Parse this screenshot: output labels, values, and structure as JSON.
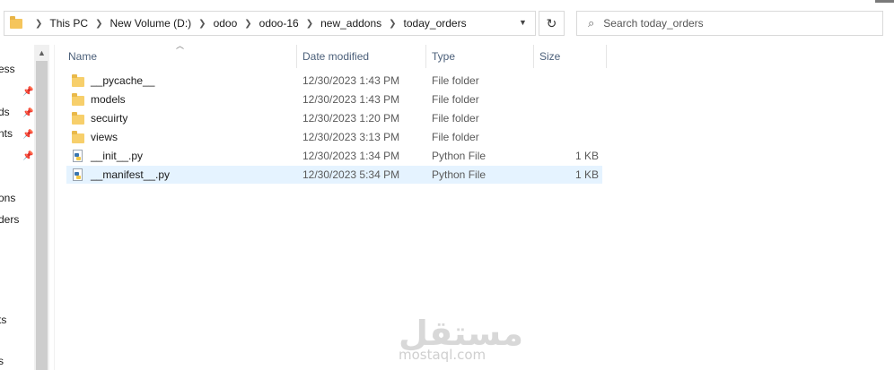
{
  "breadcrumb": [
    "This PC",
    "New Volume (D:)",
    "odoo",
    "odoo-16",
    "new_addons",
    "today_orders"
  ],
  "search": {
    "placeholder": "Search today_orders"
  },
  "nav": {
    "items": [
      "ess",
      "ds",
      "nts",
      "",
      "ons",
      "ders",
      "ts",
      "s"
    ]
  },
  "columns": {
    "name": "Name",
    "date": "Date modified",
    "type": "Type",
    "size": "Size"
  },
  "files": [
    {
      "name": "__pycache__",
      "date": "12/30/2023 1:43 PM",
      "type": "File folder",
      "size": "",
      "kind": "folder",
      "selected": false
    },
    {
      "name": "models",
      "date": "12/30/2023 1:43 PM",
      "type": "File folder",
      "size": "",
      "kind": "folder",
      "selected": false
    },
    {
      "name": "secuirty",
      "date": "12/30/2023 1:20 PM",
      "type": "File folder",
      "size": "",
      "kind": "folder",
      "selected": false
    },
    {
      "name": "views",
      "date": "12/30/2023 3:13 PM",
      "type": "File folder",
      "size": "",
      "kind": "folder",
      "selected": false
    },
    {
      "name": "__init__.py",
      "date": "12/30/2023 1:34 PM",
      "type": "Python File",
      "size": "1 KB",
      "kind": "python",
      "selected": false
    },
    {
      "name": "__manifest__.py",
      "date": "12/30/2023 5:34 PM",
      "type": "Python File",
      "size": "1 KB",
      "kind": "python",
      "selected": true
    }
  ],
  "watermark": {
    "logo": "مستقل",
    "text": "mostaql.com"
  },
  "colors": {
    "selection": "#e5f3ff",
    "header_text": "#4c607a",
    "folder": "#f7cf6b"
  },
  "icons": {
    "refresh": "refresh-icon",
    "search": "search-icon",
    "pin": "pin-icon"
  }
}
